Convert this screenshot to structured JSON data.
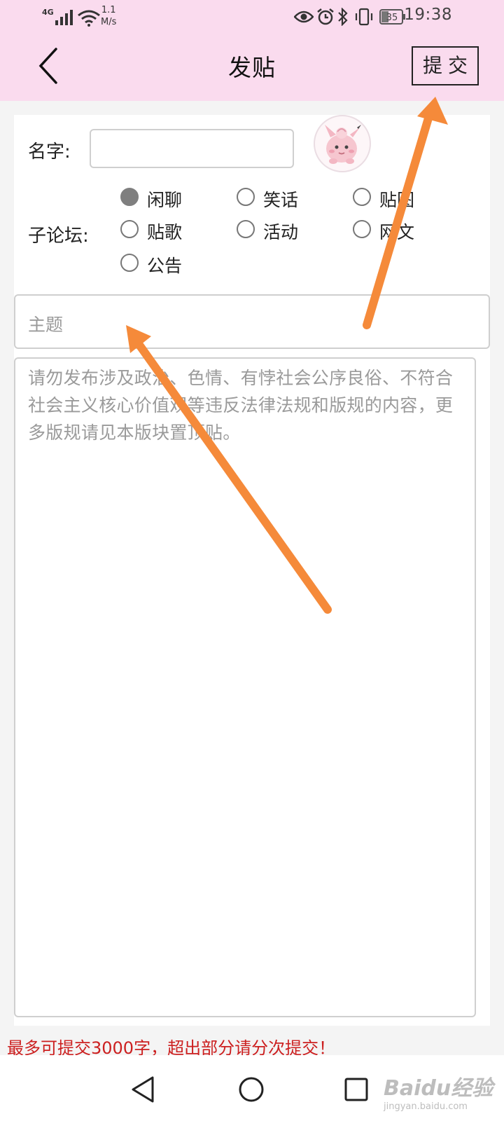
{
  "status_bar": {
    "network": "4G",
    "speed_value": "1.1",
    "speed_unit": "M/s",
    "battery": "35",
    "time": "19:38"
  },
  "header": {
    "title": "发贴",
    "submit_label": "提交",
    "background": "#fadbee"
  },
  "form": {
    "name_label": "名字:",
    "name_value": "",
    "subforum_label": "子论坛:",
    "subforums": [
      {
        "label": "闲聊",
        "checked": true
      },
      {
        "label": "笑话",
        "checked": false
      },
      {
        "label": "贴图",
        "checked": false
      },
      {
        "label": "贴歌",
        "checked": false
      },
      {
        "label": "活动",
        "checked": false
      },
      {
        "label": "网文",
        "checked": false
      },
      {
        "label": "公告",
        "checked": false
      }
    ],
    "topic_placeholder": "主题",
    "content_placeholder": "请勿发布涉及政治、色情、有悖社会公序良俗、不符合社会主义核心价值观等违反法律法规和版规的内容，更多版规请见本版块置顶贴。",
    "limit_note": "最多可提交3000字，超出部分请分次提交！"
  },
  "watermark": {
    "text": "Baidu经验",
    "subtext": "jingyan.baidu.com"
  },
  "colors": {
    "accent_arrow": "#f58a3a",
    "warning_text": "#cc1f1f"
  }
}
